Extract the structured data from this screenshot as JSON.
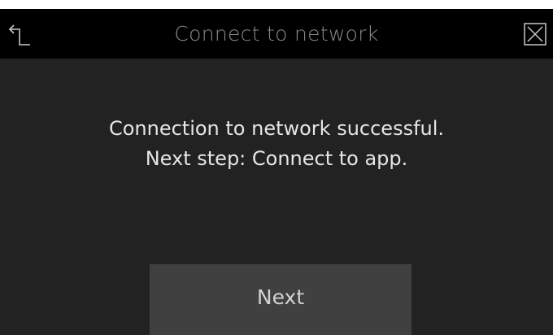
{
  "header": {
    "title": "Connect to network",
    "back_icon": "back-arrow-icon",
    "close_icon": "close-icon"
  },
  "message": {
    "line1": "Connection to network successful.",
    "line2": "Next step: Connect to app."
  },
  "actions": {
    "next_label": "Next"
  },
  "colors": {
    "header_background": "#000000",
    "screen_background": "#222222",
    "button_background": "#404040",
    "title_text": "#8a8a8a",
    "message_text": "#e6e6e6"
  }
}
